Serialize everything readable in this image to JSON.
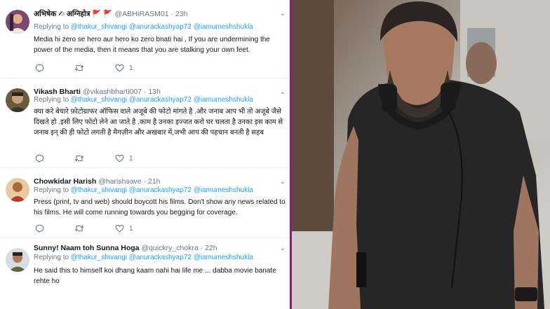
{
  "tweets": [
    {
      "name": "अभिषेक ✍ अग्निहोत्र 🚩 🚩",
      "handle": "@ABHIRASM01",
      "time": "23h",
      "replying_label": "Replying to",
      "mentions": [
        "@thakur_shivangi",
        "@anurackashyap72",
        "@iamumeshshukla"
      ],
      "text": "Media hi zero se hero aur hero ko zero bnati hai , If you are undermining the power of the media, then it means that you are stalking your own feet.",
      "reply_count": "",
      "retweet_count": "",
      "like_count": "1"
    },
    {
      "name": "Vikash Bharti",
      "handle": "@vikashbharti007",
      "time": "13h",
      "replying_label": "Replying to",
      "mentions": [
        "@thakur_shivangi",
        "@anurackashyap72",
        "@iamumeshshukla"
      ],
      "text": "क्या करे बेचारे फ़ोटोग्राफर ऑफिस वाले अजूबे की फोटो मांगते है .और जनाब आप भी तो अजूबे जैसे दिखते हो .इसी लिए फोटो लेने आ जाते है .काम है उनका इज्जत करो घर चलता है उनका इस काम से जनाब इन् की ही फोटो लगती है मैगज़ीन और अखबार में,जभी आप की पहचान बनती है सहब",
      "reply_count": "",
      "retweet_count": "",
      "like_count": "1"
    },
    {
      "name": "Chowkidar Harish",
      "handle": "@harishsave",
      "time": "21h",
      "replying_label": "Replying to",
      "mentions": [
        "@thakur_shivangi",
        "@anurackashyap72",
        "@iamumeshshukla"
      ],
      "text": "Press (print, tv and web) should boycott his films. Don't show any news related to his films. He will come running towards you begging for coverage.",
      "reply_count": "",
      "retweet_count": "",
      "like_count": "1"
    },
    {
      "name": "Sunny! Naam toh Sunna Hoga",
      "handle": "@quickry_chokra",
      "time": "22h",
      "replying_label": "Replying to",
      "mentions": [
        "@thakur_shivangi",
        "@anurackashyap72",
        "@iamumeshshukla"
      ],
      "text": "He said this to himself koi dhang kaam nahi hai life me ... dabba movie banate rehte ho",
      "reply_count": "",
      "retweet_count": "",
      "like_count": ""
    }
  ],
  "icons": {
    "reply": "reply-icon",
    "retweet": "retweet-icon",
    "like": "heart-icon",
    "more": "chevron-down-icon"
  },
  "colors": {
    "link": "#1da1f2",
    "meta": "#657786",
    "text": "#14171a",
    "divider": "#8a1c7c"
  }
}
